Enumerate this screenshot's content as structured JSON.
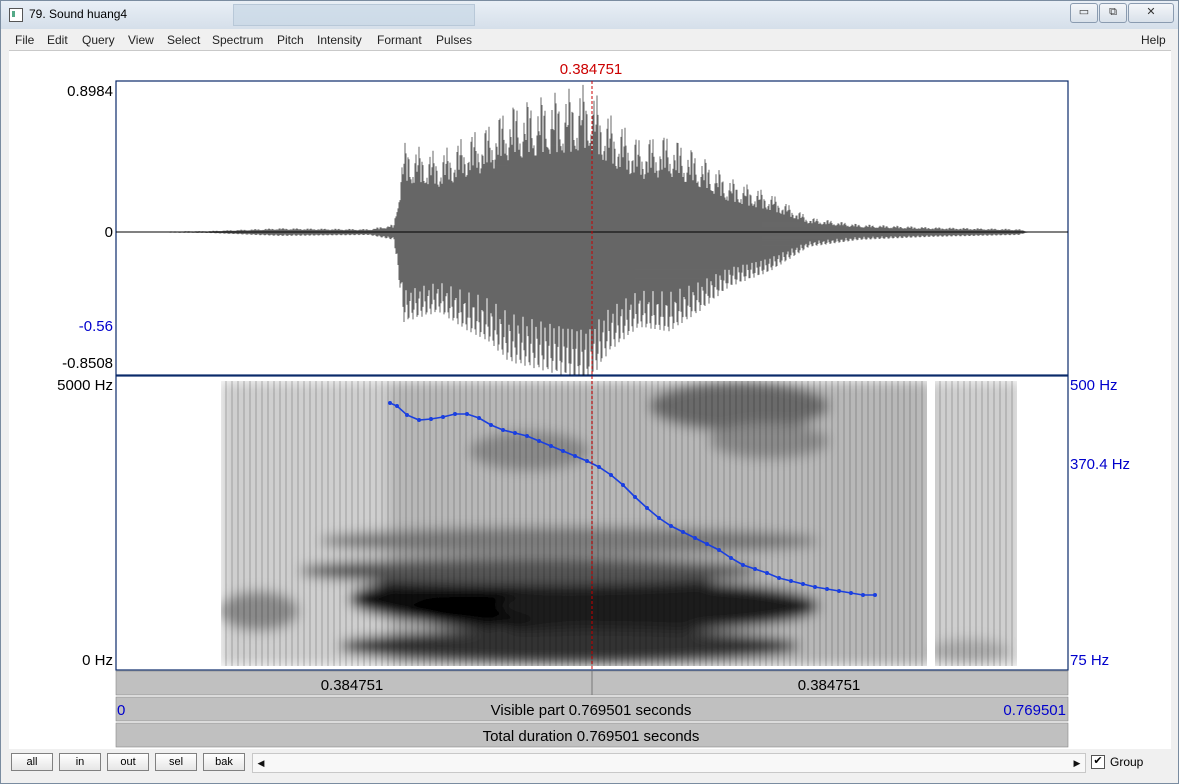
{
  "window": {
    "title": "79. Sound huang4",
    "controls": {
      "minimize": "▭",
      "restore": "⧉",
      "close": "✕"
    }
  },
  "menu": [
    "File",
    "Edit",
    "Query",
    "View",
    "Select",
    "Spectrum",
    "Pitch",
    "Intensity",
    "Formant",
    "Pulses"
  ],
  "menu_help": "Help",
  "editor": {
    "cursor_time": "0.384751",
    "waveform": {
      "top": "0.8984",
      "zero": "0",
      "mark": "-0.56",
      "bottom": "-0.8508"
    },
    "spectrogram": {
      "top": "5000 Hz",
      "bottom": "0 Hz"
    },
    "pitch_axis": {
      "top": "500 Hz",
      "mid": "370.4 Hz",
      "bottom": "75 Hz"
    },
    "time_left_segment": "0.384751",
    "time_right_segment": "0.384751",
    "visible_start": "0",
    "visible_end": "0.769501",
    "visible_label": "Visible part 0.769501 seconds",
    "total_label": "Total duration 0.769501 seconds",
    "colors": {
      "cursor": "#cc0000",
      "pitch": "#1a3fe0",
      "axis_blue": "#0000cc"
    }
  },
  "buttons": {
    "all": "all",
    "in": "in",
    "out": "out",
    "sel": "sel",
    "bak": "bak"
  },
  "scroll": {
    "left_arrow": "◀",
    "right_arrow": "▶"
  },
  "group": {
    "label": "Group",
    "checked": true,
    "check_glyph": "✔"
  }
}
